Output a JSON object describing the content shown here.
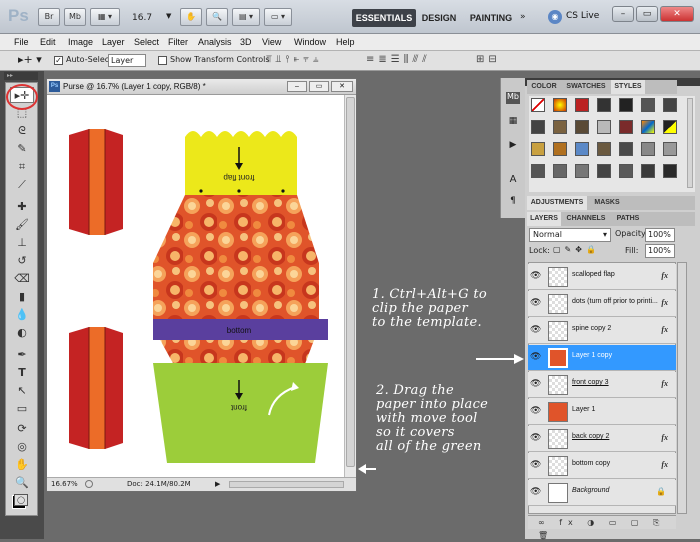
{
  "app": {
    "logo": "Ps",
    "zoom_value": "16.7"
  },
  "top_buttons": {
    "br": "Br",
    "mb": "Mb"
  },
  "workspaces": {
    "essentials": "ESSENTIALS",
    "design": "DESIGN",
    "painting": "PAINTING"
  },
  "cs_live": "CS Live",
  "menu": [
    "File",
    "Edit",
    "Image",
    "Layer",
    "Select",
    "Filter",
    "Analysis",
    "3D",
    "View",
    "Window",
    "Help"
  ],
  "options": {
    "auto_select_label": "Auto-Select:",
    "auto_select_value": "Layer",
    "show_transform_label": "Show Transform Controls"
  },
  "document": {
    "title": "Purse @ 16.7% (Layer 1 copy, RGB/8) *",
    "zoom": "16.67%",
    "doc_size": "Doc: 24.1M/80.2M",
    "labels": {
      "front_flap": "front flap",
      "bottom": "bottom",
      "front": "front"
    }
  },
  "panels": {
    "top_tabs": [
      "COLOR",
      "SWATCHES",
      "STYLES"
    ],
    "mid_tabs": [
      "ADJUSTMENTS",
      "MASKS"
    ],
    "layer_tabs": [
      "LAYERS",
      "CHANNELS",
      "PATHS"
    ],
    "blend_mode": "Normal",
    "opacity_label": "Opacity:",
    "opacity_value": "100%",
    "lock_label": "Lock:",
    "fill_label": "Fill:",
    "fill_value": "100%"
  },
  "layers": [
    {
      "name": "scalloped flap",
      "fx": "fx"
    },
    {
      "name": "dots (turn off prior to printi...",
      "fx": "fx"
    },
    {
      "name": "spine copy 2",
      "fx": "fx"
    },
    {
      "name": "Layer 1 copy",
      "fx": ""
    },
    {
      "name": "front copy 3",
      "fx": "fx"
    },
    {
      "name": "Layer 1",
      "fx": ""
    },
    {
      "name": "back copy 2",
      "fx": "fx"
    },
    {
      "name": "bottom copy",
      "fx": "fx"
    },
    {
      "name": "Background",
      "fx": ""
    }
  ],
  "annotations": {
    "step1": [
      "1. Ctrl+Alt+G to",
      "clip the paper",
      "to the template."
    ],
    "step2": [
      "2. Drag the",
      "paper into place",
      "with move tool",
      "so it covers",
      "all of the green"
    ]
  },
  "colors": {
    "selection_blue": "#3399ff",
    "flap_yellow": "#ece81a",
    "paper_orange": "#e0542a",
    "band_purple": "#5a3f9e",
    "green": "#9ccd3a",
    "spine_red": "#c42323",
    "spine_orange": "#ec6c28",
    "circle_red": "#d33"
  }
}
